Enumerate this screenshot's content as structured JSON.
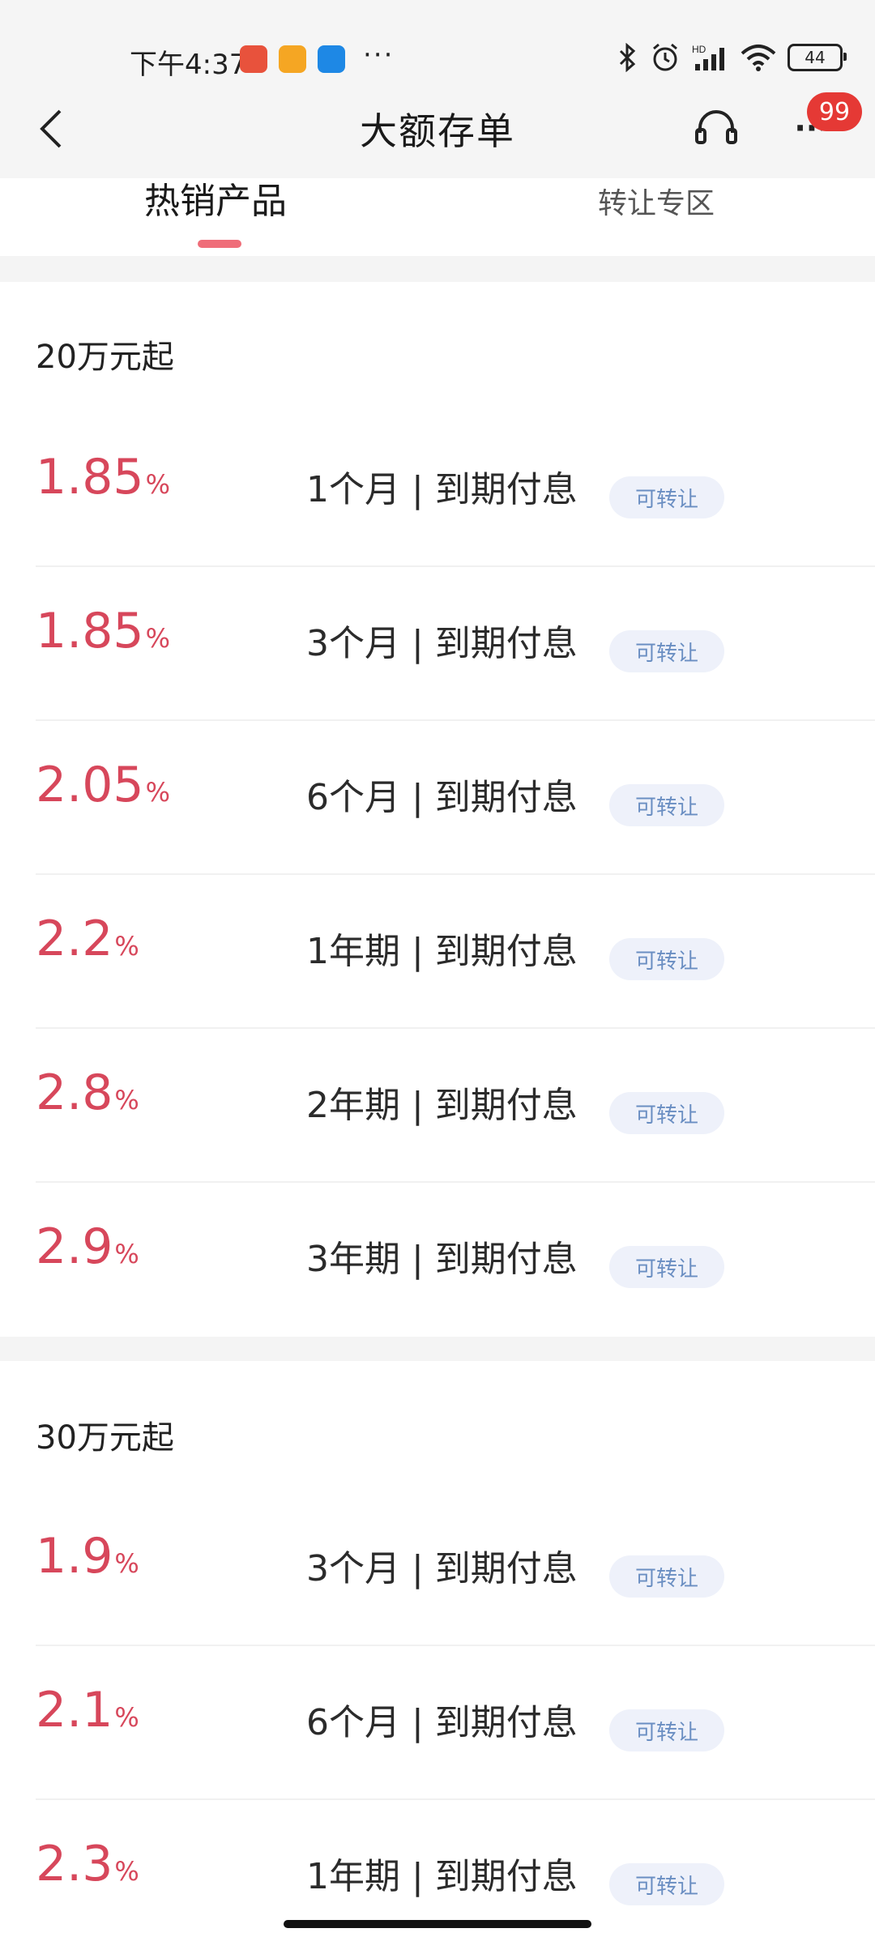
{
  "status_bar": {
    "time": "下午4:37",
    "battery": "44",
    "more_dots": "···"
  },
  "header": {
    "title": "大额存单",
    "badge_count": "99"
  },
  "tabs": {
    "hot": "热销产品",
    "transfer": "转让专区"
  },
  "sections": [
    {
      "title": "20万元起",
      "products": [
        {
          "rate": "1.85",
          "pct": "%",
          "term": "1个月 | 到期付息",
          "tag": "可转让"
        },
        {
          "rate": "1.85",
          "pct": "%",
          "term": "3个月 | 到期付息",
          "tag": "可转让"
        },
        {
          "rate": "2.05",
          "pct": "%",
          "term": "6个月 | 到期付息",
          "tag": "可转让"
        },
        {
          "rate": "2.2",
          "pct": "%",
          "term": "1年期 | 到期付息",
          "tag": "可转让"
        },
        {
          "rate": "2.8",
          "pct": "%",
          "term": "2年期 | 到期付息",
          "tag": "可转让"
        },
        {
          "rate": "2.9",
          "pct": "%",
          "term": "3年期 | 到期付息",
          "tag": "可转让"
        }
      ]
    },
    {
      "title": "30万元起",
      "products": [
        {
          "rate": "1.9",
          "pct": "%",
          "term": "3个月 | 到期付息",
          "tag": "可转让"
        },
        {
          "rate": "2.1",
          "pct": "%",
          "term": "6个月 | 到期付息",
          "tag": "可转让"
        },
        {
          "rate": "2.3",
          "pct": "%",
          "term": "1年期 | 到期付息",
          "tag": "可转让"
        }
      ]
    }
  ],
  "colors": {
    "rate": "#d7475b",
    "accent_indicator": "#ef6d79",
    "badge": "#e53935",
    "tag_bg": "#eef1fa",
    "tag_text": "#6a8ec2"
  }
}
